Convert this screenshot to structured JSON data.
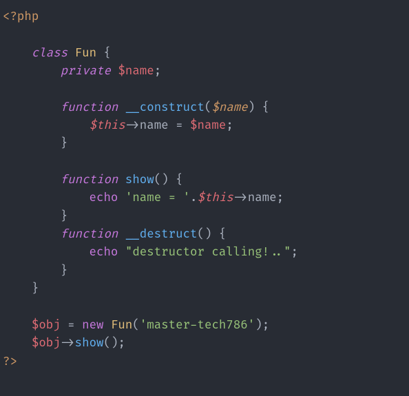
{
  "code": {
    "open_tag": "<?php",
    "close_tag": "?>",
    "kw_class": "class",
    "class_name": "Fun",
    "brace_open": "{",
    "brace_close": "}",
    "kw_private": "private",
    "var_name": "$name",
    "semicolon": ";",
    "kw_function": "function",
    "fn_construct": "__construct",
    "paren_open": "(",
    "paren_close": ")",
    "param_name": "$name",
    "var_this": "$this",
    "arrow": "->",
    "prop_name": "name",
    "assign": " = ",
    "fn_show": "show",
    "kw_echo": "echo",
    "str_name_eq": "'name = '",
    "concat": ".",
    "fn_destruct": "__destruct",
    "str_destructor": "\"destructor calling!..\"",
    "var_obj": "$obj",
    "kw_new": "new",
    "str_arg": "'master-tech786'"
  }
}
